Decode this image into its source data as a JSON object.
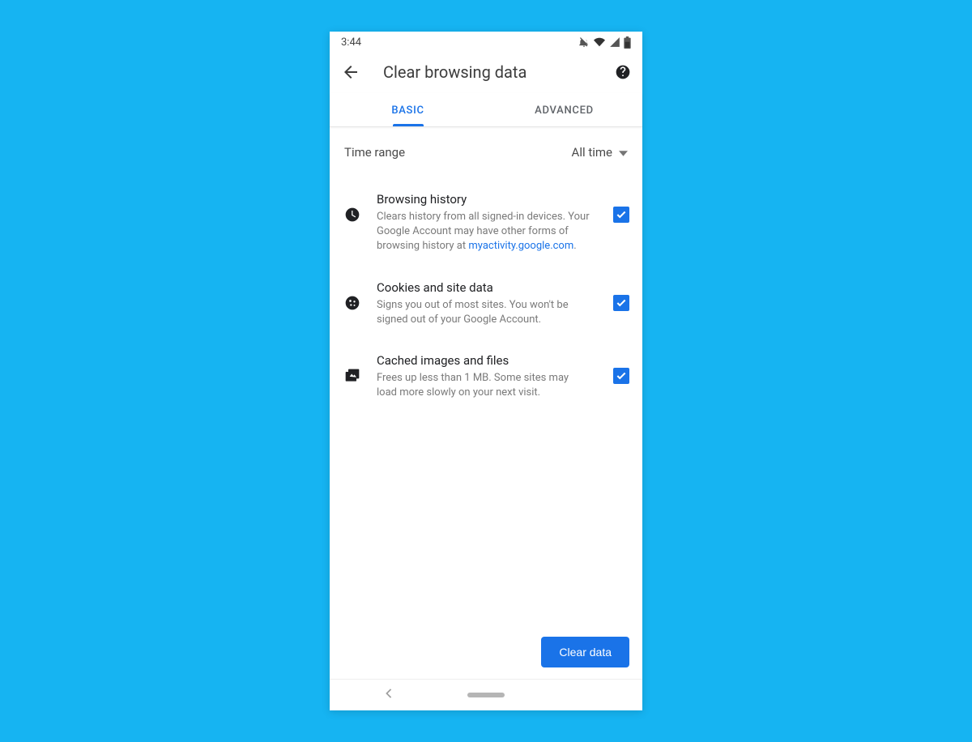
{
  "statusbar": {
    "time": "3:44"
  },
  "header": {
    "title": "Clear browsing data"
  },
  "tabs": {
    "basic": "BASIC",
    "advanced": "ADVANCED"
  },
  "time_range": {
    "label": "Time range",
    "value": "All time"
  },
  "options": {
    "history": {
      "title": "Browsing history",
      "desc_pre": "Clears history from all signed-in devices. Your Google Account may have other forms of browsing history at ",
      "desc_link": "myactivity.google.com",
      "desc_post": "."
    },
    "cookies": {
      "title": "Cookies and site data",
      "desc": "Signs you out of most sites. You won't be signed out of your Google Account."
    },
    "cache": {
      "title": "Cached images and files",
      "desc": "Frees up less than 1 MB. Some sites may load more slowly on your next visit."
    }
  },
  "footer": {
    "clear_button": "Clear data"
  }
}
